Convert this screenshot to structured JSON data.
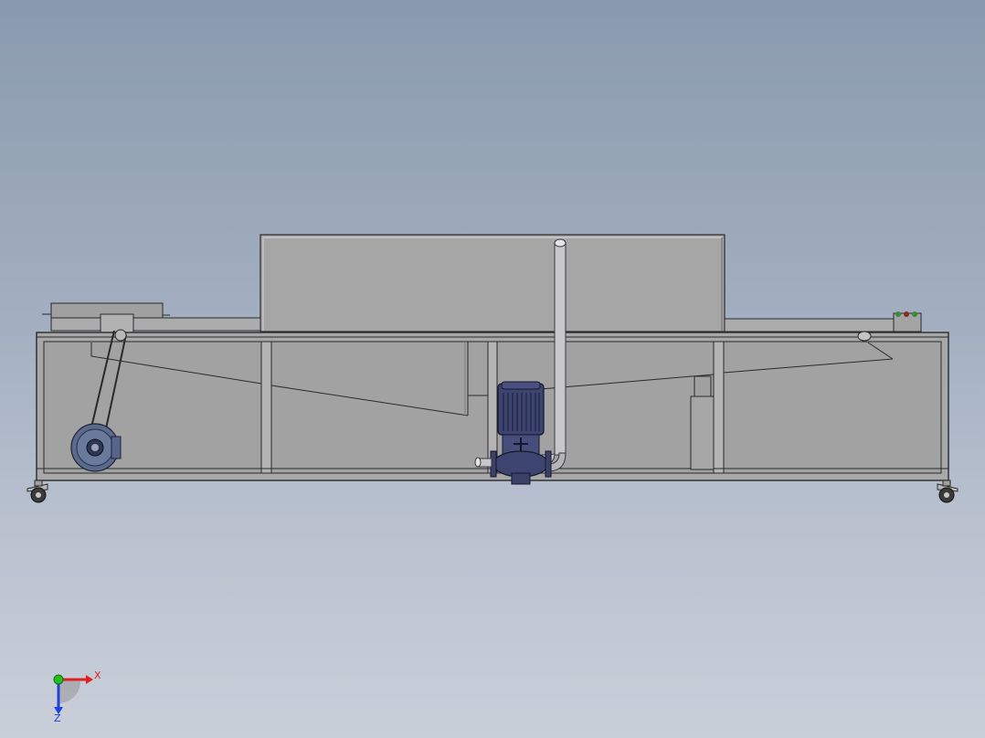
{
  "viewport": {
    "background_top": "#8a9aae",
    "background_bottom": "#c9cfd9"
  },
  "model": {
    "frame_color": "#a8a8a8",
    "panel_color": "#a2a2a2",
    "outline_color": "#2a2a2a",
    "motor_color": "#5a6a8c",
    "pump_color": "#3e4470",
    "pipe_color": "#c8c8cc"
  },
  "triad": {
    "x_label": "X",
    "z_label": "Z",
    "x_color": "#e02020",
    "y_color": "#20c020",
    "z_color": "#2040e0"
  }
}
